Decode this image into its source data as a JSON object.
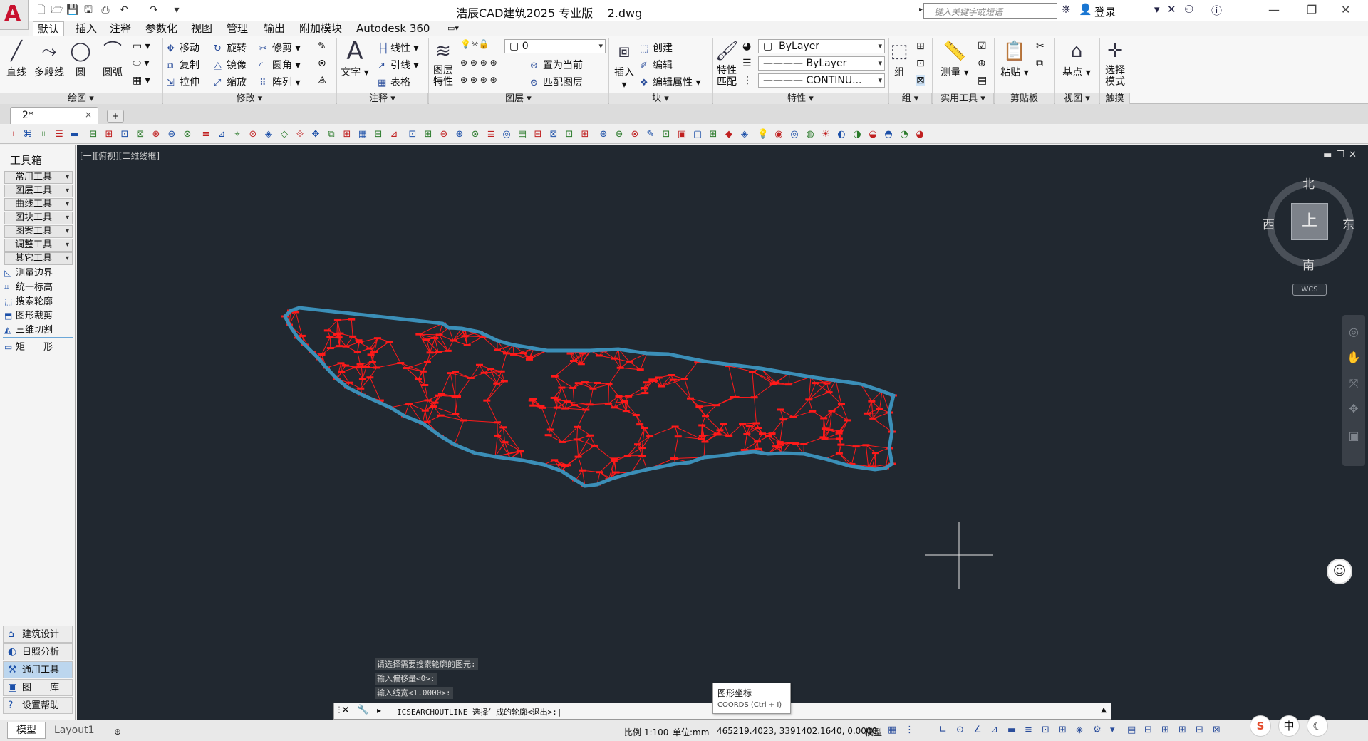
{
  "title_bar": {
    "app_name": "浩辰CAD建筑2025 专业版",
    "file_name": "2.dwg",
    "search_placeholder": "键入关键字或短语",
    "login_label": "登录",
    "logo_letter": "A"
  },
  "ribbon_tabs": [
    "默认",
    "插入",
    "注释",
    "参数化",
    "视图",
    "管理",
    "输出",
    "附加模块",
    "Autodesk 360"
  ],
  "ribbon": {
    "draw": {
      "title": "绘图",
      "line": "直线",
      "polyline": "多段线",
      "circle": "圆",
      "arc": "圆弧"
    },
    "modify": {
      "title": "修改",
      "move": "移动",
      "rotate": "旋转",
      "trim": "修剪",
      "copy": "复制",
      "mirror": "镜像",
      "fillet": "圆角",
      "stretch": "拉伸",
      "scale": "缩放",
      "array": "阵列"
    },
    "annotation": {
      "title": "注释",
      "text": "文字",
      "linear": "线性",
      "leader": "引线",
      "table": "表格"
    },
    "layers": {
      "title": "图层",
      "layer_props_1": "图层",
      "layer_props_2": "特性",
      "current_layer": "0",
      "set_current": "置为当前",
      "match_layer": "匹配图层"
    },
    "block": {
      "title": "块",
      "insert": "插入",
      "create": "创建",
      "edit": "编辑",
      "edit_attr": "编辑属性"
    },
    "properties": {
      "title": "特性",
      "match_1": "特性",
      "match_2": "匹配",
      "color": "ByLayer",
      "linetype": "ByLayer",
      "lineweight": "CONTINU..."
    },
    "groups": {
      "title": "组",
      "group": "组"
    },
    "utilities": {
      "title": "实用工具",
      "measure": "测量"
    },
    "clipboard": {
      "title": "剪贴板",
      "paste": "粘贴"
    },
    "view": {
      "title": "视图",
      "base": "基点"
    },
    "select": {
      "label_1": "选择",
      "label_2": "模式",
      "title": "触摸"
    }
  },
  "doc_tab": {
    "name": "2*",
    "close": "×",
    "new": "+"
  },
  "toolbox": {
    "title": "工具箱",
    "groups": [
      "常用工具",
      "图层工具",
      "曲线工具",
      "图块工具",
      "图案工具",
      "调整工具",
      "其它工具"
    ],
    "items": [
      "测量边界",
      "统一标高",
      "搜索轮廓",
      "图形裁剪",
      "三维切割",
      "矩　　形"
    ],
    "bottom": [
      "建筑设计",
      "日照分析",
      "通用工具",
      "图　　库",
      "设置帮助"
    ]
  },
  "canvas": {
    "view_label": "[一][俯视][二维线框]",
    "background": "#212830",
    "mesh_color": "#ff1a1a",
    "outline_color": "#3b8fb8"
  },
  "viewcube": {
    "north": "北",
    "south": "南",
    "east": "东",
    "west": "西",
    "face": "上",
    "wcs": "WCS"
  },
  "command": {
    "history": [
      "请选择需要搜索轮廓的图元:",
      "输入偏移量<0>:",
      "输入线宽<1.0000>:"
    ],
    "current": "ICSEARCHOUTLINE 选择生成的轮廓<退出>:"
  },
  "tooltip": {
    "title": "图形坐标",
    "subtitle": "COORDS (Ctrl + I)"
  },
  "statusbar": {
    "model_tab": "模型",
    "layout_tab": "Layout1",
    "scale": "比例 1:100",
    "units": "单位:mm",
    "coords": "465219.4023, 3391402.1640, 0.0000",
    "mode": "模型"
  },
  "ime": {
    "app": "S",
    "lang": "中",
    "moon": "☾"
  }
}
